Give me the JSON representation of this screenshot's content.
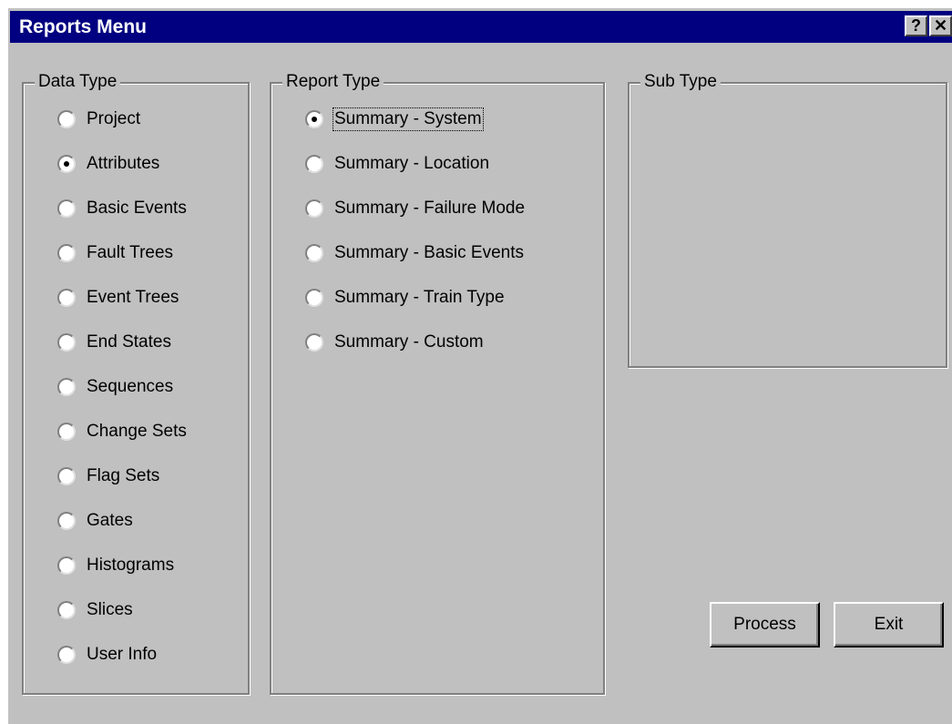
{
  "window": {
    "title": "Reports Menu",
    "help_glyph": "?",
    "close_glyph": "✕"
  },
  "data_type": {
    "label": "Data Type",
    "selected": "Attributes",
    "options": [
      "Project",
      "Attributes",
      "Basic Events",
      "Fault Trees",
      "Event Trees",
      "End States",
      "Sequences",
      "Change Sets",
      "Flag Sets",
      "Gates",
      "Histograms",
      "Slices",
      "User Info"
    ]
  },
  "report_type": {
    "label": "Report Type",
    "selected": "Summary - System",
    "options": [
      "Summary - System",
      "Summary - Location",
      "Summary - Failure Mode",
      "Summary - Basic Events",
      "Summary - Train Type",
      "Summary - Custom"
    ]
  },
  "sub_type": {
    "label": "Sub Type"
  },
  "buttons": {
    "process": "Process",
    "exit": "Exit"
  }
}
